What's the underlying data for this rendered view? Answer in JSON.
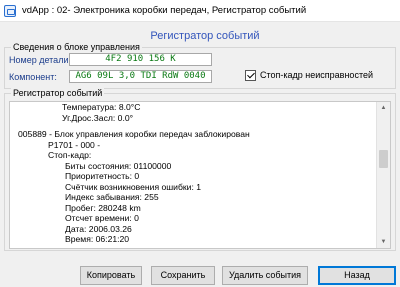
{
  "window": {
    "title": "vdApp : 02- Электроника коробки передач,  Регистратор событий"
  },
  "page": {
    "heading": "Регистратор событий"
  },
  "ecu_info": {
    "caption": "Сведения о блоке управления",
    "part_number_label": "Номер детали:",
    "part_number_value": "4F2 910 156 K",
    "component_label": "Компонент:",
    "component_value": "AG6 09L 3,0 TDI RdW 0040",
    "freeze_frame_label": "Стоп-кадр неисправностей",
    "freeze_frame_checked": true
  },
  "event_log": {
    "caption": "Регистратор событий",
    "lines": [
      {
        "text": "Температура: 8.0°C",
        "indent": 2
      },
      {
        "text": "Уг.Дрос.Засл: 0.0°",
        "indent": 2
      },
      {
        "text": "",
        "indent": 0
      },
      {
        "text": "005889 - Блок управления коробки передач заблокирован",
        "indent": 0
      },
      {
        "text": "P1701 - 000 -",
        "indent": 1
      },
      {
        "text": "Стоп-кадр:",
        "indent": 1
      },
      {
        "text": "Биты состояния: 01100000",
        "indent": 3
      },
      {
        "text": "Приоритетность: 0",
        "indent": 3
      },
      {
        "text": "Счётчик возникновения ошибки: 1",
        "indent": 3
      },
      {
        "text": "Индекс забывания: 255",
        "indent": 3
      },
      {
        "text": "Пробег: 280248 km",
        "indent": 3
      },
      {
        "text": "Отсчет времени: 0",
        "indent": 3
      },
      {
        "text": "Дата: 2006.03.26",
        "indent": 3
      },
      {
        "text": "Время: 06:21:20",
        "indent": 3
      }
    ]
  },
  "buttons": {
    "copy": "Копировать",
    "save": "Сохранить",
    "delete": "Удалить события",
    "back": "Назад"
  },
  "icons": {
    "app": "app-window-icon",
    "scroll_up": "scroll-up-arrow-icon",
    "scroll_down": "scroll-down-arrow-icon"
  },
  "colors": {
    "heading": "#3355bb",
    "field_label": "#1c3d8c",
    "field_value": "#0b7a14",
    "primary_border": "#0078d7"
  }
}
